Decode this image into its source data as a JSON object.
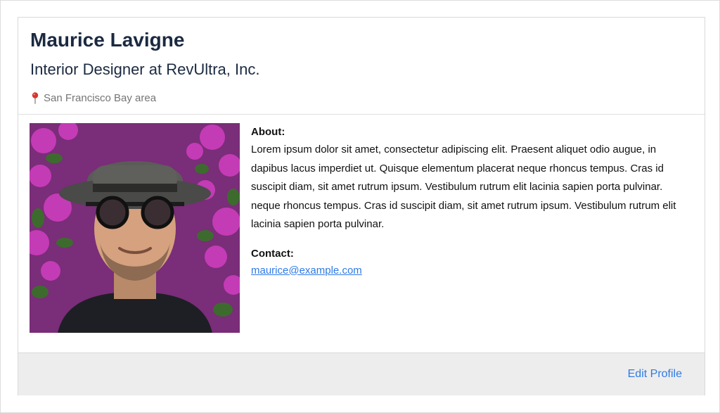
{
  "profile": {
    "name": "Maurice Lavigne",
    "title": "Interior Designer at RevUltra, Inc.",
    "location": "San Francisco Bay area",
    "location_icon": "map-pin-icon"
  },
  "about": {
    "label": "About:",
    "text": "Lorem ipsum dolor sit amet, consectetur adipiscing elit. Praesent aliquet odio augue, in dapibus lacus imperdiet ut. Quisque elementum placerat neque rhoncus tempus. Cras id suscipit diam, sit amet rutrum ipsum. Vestibulum rutrum elit lacinia sapien porta pulvinar. neque rhoncus tempus. Cras id suscipit diam, sit amet rutrum ipsum. Vestibulum rutrum elit lacinia sapien porta pulvinar."
  },
  "contact": {
    "label": "Contact:",
    "email": "maurice@example.com"
  },
  "footer": {
    "edit_label": "Edit Profile"
  },
  "colors": {
    "name_text": "#1b2a41",
    "link": "#2f7ae5",
    "footer_bg": "#ededed",
    "pin": "#d9342b"
  }
}
